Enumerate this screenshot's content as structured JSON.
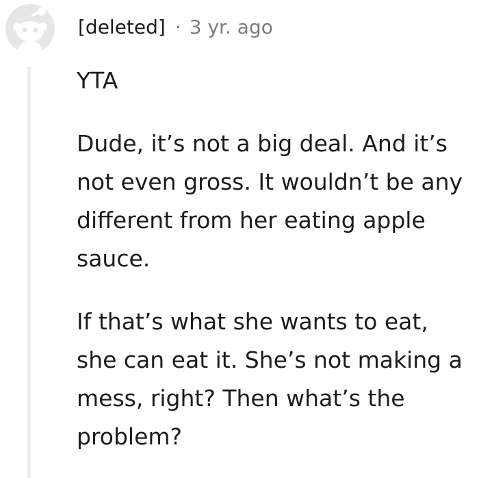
{
  "comment": {
    "author": "[deleted]",
    "separator": "·",
    "timestamp": "3 yr. ago",
    "avatar_icon": "default-snoo-avatar-icon",
    "colors": {
      "avatar": "#e6e6e6",
      "meta_gray": "#7c7c7c",
      "thread_line": "#ededed",
      "text": "#1c1c1c"
    },
    "paragraphs": [
      "YTA",
      "Dude, it’s not a big deal. And it’s not even gross. It wouldn’t be any different from her eating apple sauce.",
      "If that’s what she wants to eat, she can eat it. She’s not making a mess, right? Then what’s the problem?"
    ]
  }
}
